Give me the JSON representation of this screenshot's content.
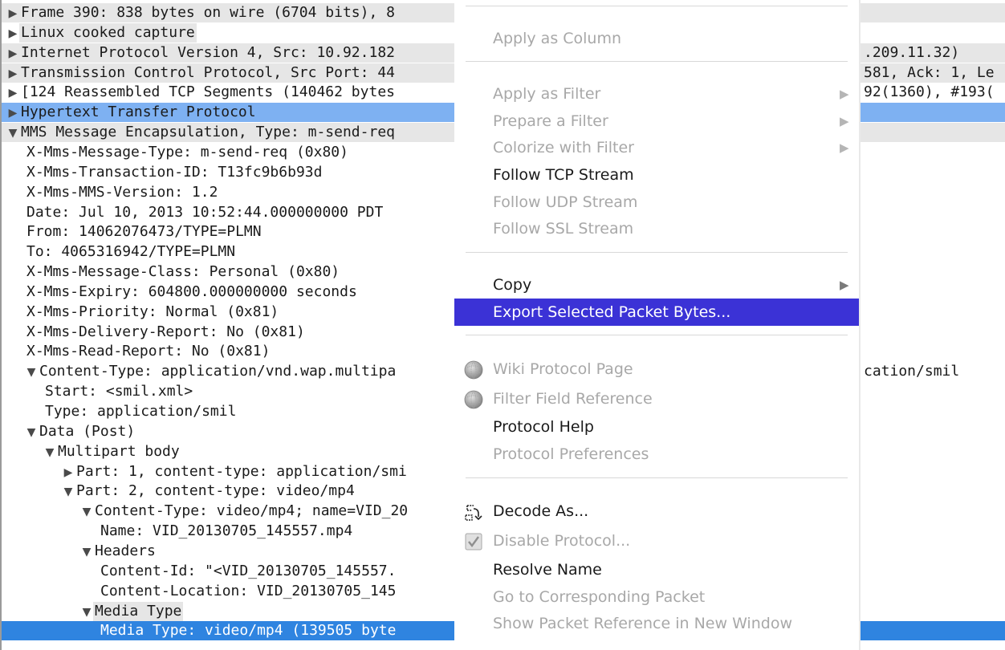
{
  "tree_rows": [
    {
      "indent": 0,
      "toggle": "▶",
      "text": "Frame 390: 838 bytes on wire (6704 bits), 8",
      "style": "hl"
    },
    {
      "indent": 0,
      "toggle": "▶",
      "text": "Linux cooked capture",
      "style": "hlbox"
    },
    {
      "indent": 0,
      "toggle": "▶",
      "text": "Internet Protocol Version 4, Src: 10.92.182",
      "style": "hl"
    },
    {
      "indent": 0,
      "toggle": "▶",
      "text": "Transmission Control Protocol, Src Port: 44",
      "style": "hl"
    },
    {
      "indent": 0,
      "toggle": "▶",
      "text": "[124 Reassembled TCP Segments (140462 bytes",
      "style": ""
    },
    {
      "indent": 0,
      "toggle": "▶",
      "text": "Hypertext Transfer Protocol",
      "style": "sel"
    },
    {
      "indent": 0,
      "toggle": "▼",
      "text": "MMS Message Encapsulation, Type: m-send-req",
      "style": "hl"
    },
    {
      "indent": 1,
      "toggle": "",
      "text": "X-Mms-Message-Type: m-send-req (0x80)",
      "style": ""
    },
    {
      "indent": 1,
      "toggle": "",
      "text": "X-Mms-Transaction-ID: T13fc9b6b93d",
      "style": ""
    },
    {
      "indent": 1,
      "toggle": "",
      "text": "X-Mms-MMS-Version: 1.2",
      "style": ""
    },
    {
      "indent": 1,
      "toggle": "",
      "text": "Date: Jul 10, 2013 10:52:44.000000000 PDT",
      "style": ""
    },
    {
      "indent": 1,
      "toggle": "",
      "text": "From: 14062076473/TYPE=PLMN",
      "style": ""
    },
    {
      "indent": 1,
      "toggle": "",
      "text": "To: 4065316942/TYPE=PLMN",
      "style": ""
    },
    {
      "indent": 1,
      "toggle": "",
      "text": "X-Mms-Message-Class: Personal (0x80)",
      "style": ""
    },
    {
      "indent": 1,
      "toggle": "",
      "text": "X-Mms-Expiry: 604800.000000000 seconds",
      "style": ""
    },
    {
      "indent": 1,
      "toggle": "",
      "text": "X-Mms-Priority: Normal (0x81)",
      "style": ""
    },
    {
      "indent": 1,
      "toggle": "",
      "text": "X-Mms-Delivery-Report: No (0x81)",
      "style": ""
    },
    {
      "indent": 1,
      "toggle": "",
      "text": "X-Mms-Read-Report: No (0x81)",
      "style": ""
    },
    {
      "indent": 1,
      "toggle": "▼",
      "text": "Content-Type: application/vnd.wap.multipa",
      "style": ""
    },
    {
      "indent": 2,
      "toggle": "",
      "text": "Start: <smil.xml>",
      "style": ""
    },
    {
      "indent": 2,
      "toggle": "",
      "text": "Type: application/smil",
      "style": ""
    },
    {
      "indent": 1,
      "toggle": "▼",
      "text": "Data (Post)",
      "style": ""
    },
    {
      "indent": 2,
      "toggle": "▼",
      "text": "Multipart body",
      "style": ""
    },
    {
      "indent": 3,
      "toggle": "▶",
      "text": "Part: 1, content-type: application/smi",
      "style": ""
    },
    {
      "indent": 3,
      "toggle": "▼",
      "text": "Part: 2, content-type: video/mp4",
      "style": ""
    },
    {
      "indent": 4,
      "toggle": "▼",
      "text": "Content-Type: video/mp4; name=VID_20",
      "style": ""
    },
    {
      "indent": 5,
      "toggle": "",
      "text": "Name: VID_20130705_145557.mp4",
      "style": ""
    },
    {
      "indent": 4,
      "toggle": "▼",
      "text": "Headers",
      "style": ""
    },
    {
      "indent": 5,
      "toggle": "",
      "text": "Content-Id: \"<VID_20130705_145557.",
      "style": ""
    },
    {
      "indent": 5,
      "toggle": "",
      "text": "Content-Location: VID_20130705_145",
      "style": ""
    },
    {
      "indent": 4,
      "toggle": "▼",
      "text": "Media Type",
      "style": "hlbox"
    },
    {
      "indent": 5,
      "toggle": "",
      "text": "Media Type: video/mp4 (139505 byte",
      "style": "selstrong"
    }
  ],
  "right_fragments": [
    {
      "row": 2,
      "text": ".209.11.32)"
    },
    {
      "row": 3,
      "text": "581, Ack: 1, Le"
    },
    {
      "row": 4,
      "text": "92(1360), #193("
    },
    {
      "row": 18,
      "text": "cation/smil"
    }
  ],
  "context_menu": {
    "items": [
      {
        "label": "Apply as Column",
        "enabled": false,
        "submenu": false,
        "icon": ""
      },
      {
        "label": "Apply as Filter",
        "enabled": false,
        "submenu": true,
        "icon": ""
      },
      {
        "label": "Prepare a Filter",
        "enabled": false,
        "submenu": true,
        "icon": ""
      },
      {
        "label": "Colorize with Filter",
        "enabled": false,
        "submenu": true,
        "icon": ""
      },
      {
        "label": "Follow TCP Stream",
        "enabled": true,
        "submenu": false,
        "icon": ""
      },
      {
        "label": "Follow UDP Stream",
        "enabled": false,
        "submenu": false,
        "icon": ""
      },
      {
        "label": "Follow SSL Stream",
        "enabled": false,
        "submenu": false,
        "icon": ""
      },
      {
        "label": "Copy",
        "enabled": true,
        "submenu": true,
        "icon": ""
      },
      {
        "label": "Export Selected Packet Bytes...",
        "enabled": true,
        "submenu": false,
        "icon": "",
        "active": true
      },
      {
        "label": "Wiki Protocol Page",
        "enabled": false,
        "submenu": false,
        "icon": "globe-icon"
      },
      {
        "label": "Filter Field Reference",
        "enabled": false,
        "submenu": false,
        "icon": "globe-icon"
      },
      {
        "label": "Protocol Help",
        "enabled": true,
        "submenu": false,
        "icon": ""
      },
      {
        "label": "Protocol Preferences",
        "enabled": false,
        "submenu": false,
        "icon": ""
      },
      {
        "label": "Decode As...",
        "enabled": true,
        "submenu": false,
        "icon": "decode-icon"
      },
      {
        "label": "Disable Protocol...",
        "enabled": false,
        "submenu": false,
        "icon": "checkbox-icon"
      },
      {
        "label": "Resolve Name",
        "enabled": true,
        "submenu": false,
        "icon": ""
      },
      {
        "label": "Go to Corresponding Packet",
        "enabled": false,
        "submenu": false,
        "icon": ""
      },
      {
        "label": "Show Packet Reference in New Window",
        "enabled": false,
        "submenu": false,
        "icon": ""
      }
    ]
  },
  "colors": {
    "selection": "#7eb1f2",
    "selection_strong": "#2f84e0",
    "menu_active": "#3b32d6",
    "disabled_text": "#a8a8a8",
    "row_highlight": "#e6e6e6"
  }
}
